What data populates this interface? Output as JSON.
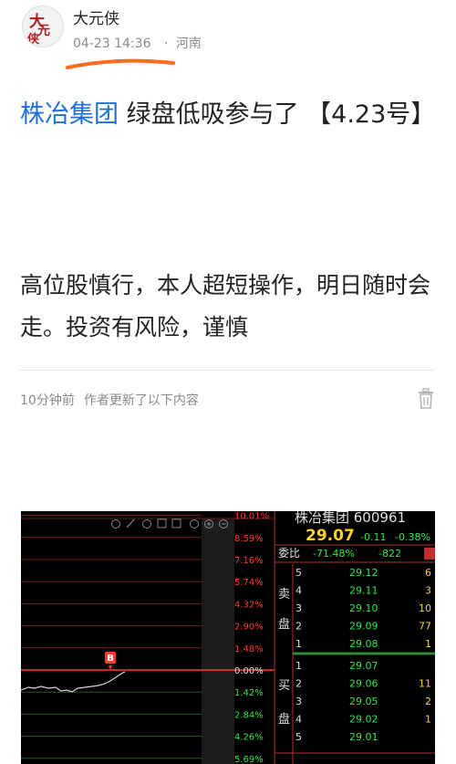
{
  "author": {
    "name": "大元侠",
    "avatar_text": "大元侠"
  },
  "meta": {
    "time": "04-23 14:36",
    "separator": "·",
    "region": "河南"
  },
  "post": {
    "title_stock": "株冶集团",
    "title_rest": " 绿盘低吸参与了 【4.23号】",
    "body": "高位股慎行，本人超短操作，明日随时会走。投资有风险，谨慎"
  },
  "update_bar": {
    "age": "10分钟前",
    "message": "作者更新了以下内容",
    "icon": "trash-icon"
  },
  "screenshot": {
    "stock_name": "株冶集团 600961",
    "price": "29.07",
    "change": "-0.11",
    "change_pct": "-0.38%",
    "weibi_label": "委比",
    "weibi_value": "-71.48%",
    "weicha_value": "-822",
    "sell_side_label": "卖盘",
    "buy_side_label": "买盘",
    "buy_marker": "B",
    "percent_labels_up": [
      "10.01%",
      "8.59%",
      "7.16%",
      "5.74%",
      "4.32%",
      "2.90%",
      "1.48%"
    ],
    "percent_zero": "0.00%",
    "percent_labels_down": [
      "1.42%",
      "2.84%",
      "4.26%",
      "5.69%"
    ],
    "asks": [
      {
        "level": "5",
        "price": "29.12",
        "vol": "6"
      },
      {
        "level": "4",
        "price": "29.11",
        "vol": "3"
      },
      {
        "level": "3",
        "price": "29.10",
        "vol": "10"
      },
      {
        "level": "2",
        "price": "29.09",
        "vol": "77"
      },
      {
        "level": "1",
        "price": "29.08",
        "vol": "1"
      }
    ],
    "bids": [
      {
        "level": "1",
        "price": "29.07",
        "vol": ""
      },
      {
        "level": "2",
        "price": "29.06",
        "vol": "11"
      },
      {
        "level": "3",
        "price": "29.05",
        "vol": "2"
      },
      {
        "level": "4",
        "price": "29.02",
        "vol": "1"
      },
      {
        "level": "5",
        "price": "29.01",
        "vol": ""
      }
    ],
    "colors": {
      "up": "#ff3b30",
      "down": "#2ee84a",
      "price": "#ffd21f",
      "neutral": "#e0e0e0"
    }
  }
}
